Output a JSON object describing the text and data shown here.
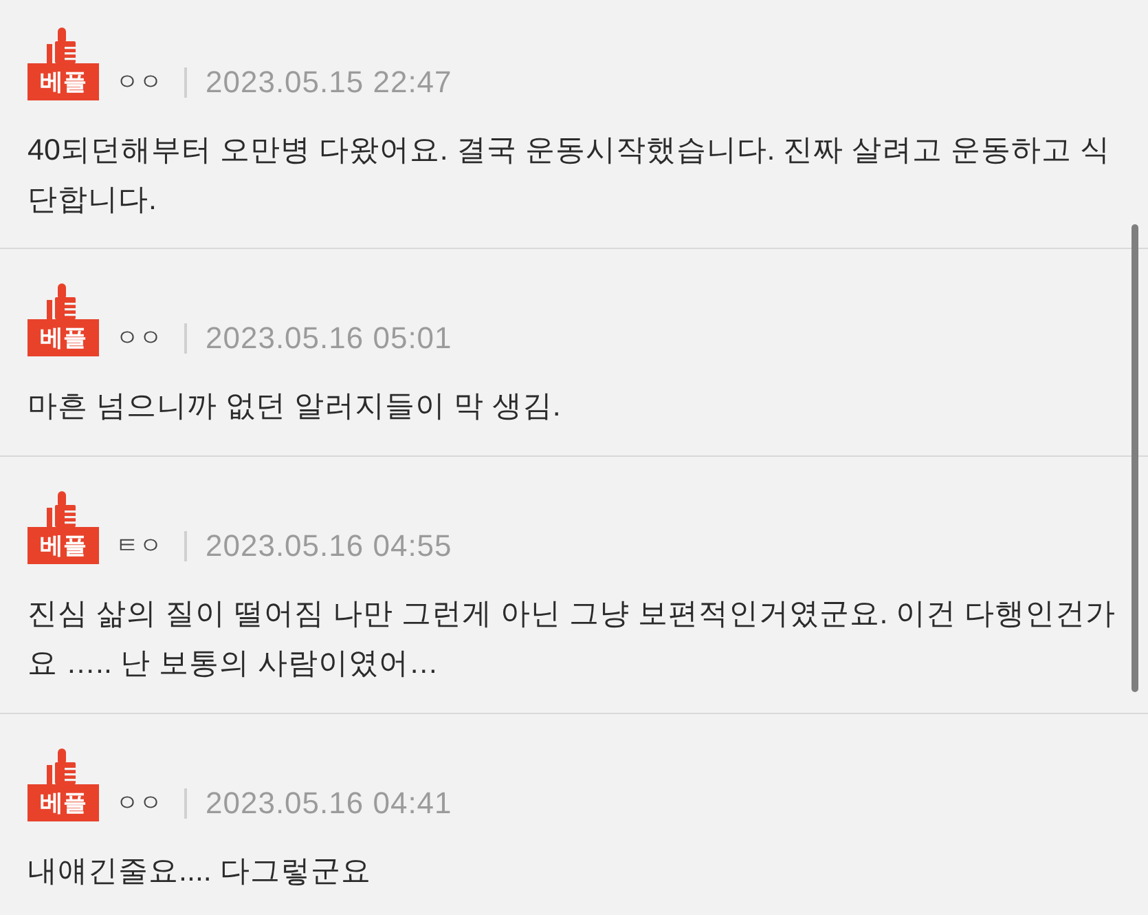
{
  "comments": [
    {
      "badge": "베플",
      "author": "ㅇㅇ",
      "date": "2023.05.15 22:47",
      "lines": [
        "40되던해부터 오만병 다왔어요. 결국 운동시작했습니다. 진짜 살려고 운동하고 식",
        "단합니다."
      ]
    },
    {
      "badge": "베플",
      "author": "ㅇㅇ",
      "date": "2023.05.16 05:01",
      "lines": [
        "마흔 넘으니까 없던 알러지들이 막 생김."
      ]
    },
    {
      "badge": "베플",
      "author": "ㅌㅇ",
      "date": "2023.05.16 04:55",
      "lines": [
        "진심 삶의 질이 떨어짐 나만 그런게 아닌 그냥 보편적인거였군요. 이건 다행인건가",
        "요 ….. 난 보통의 사람이였어…"
      ]
    },
    {
      "badge": "베플",
      "author": "ㅇㅇ",
      "date": "2023.05.16 04:41",
      "lines": [
        "내얘긴줄요.... 다그렇군요"
      ]
    }
  ]
}
